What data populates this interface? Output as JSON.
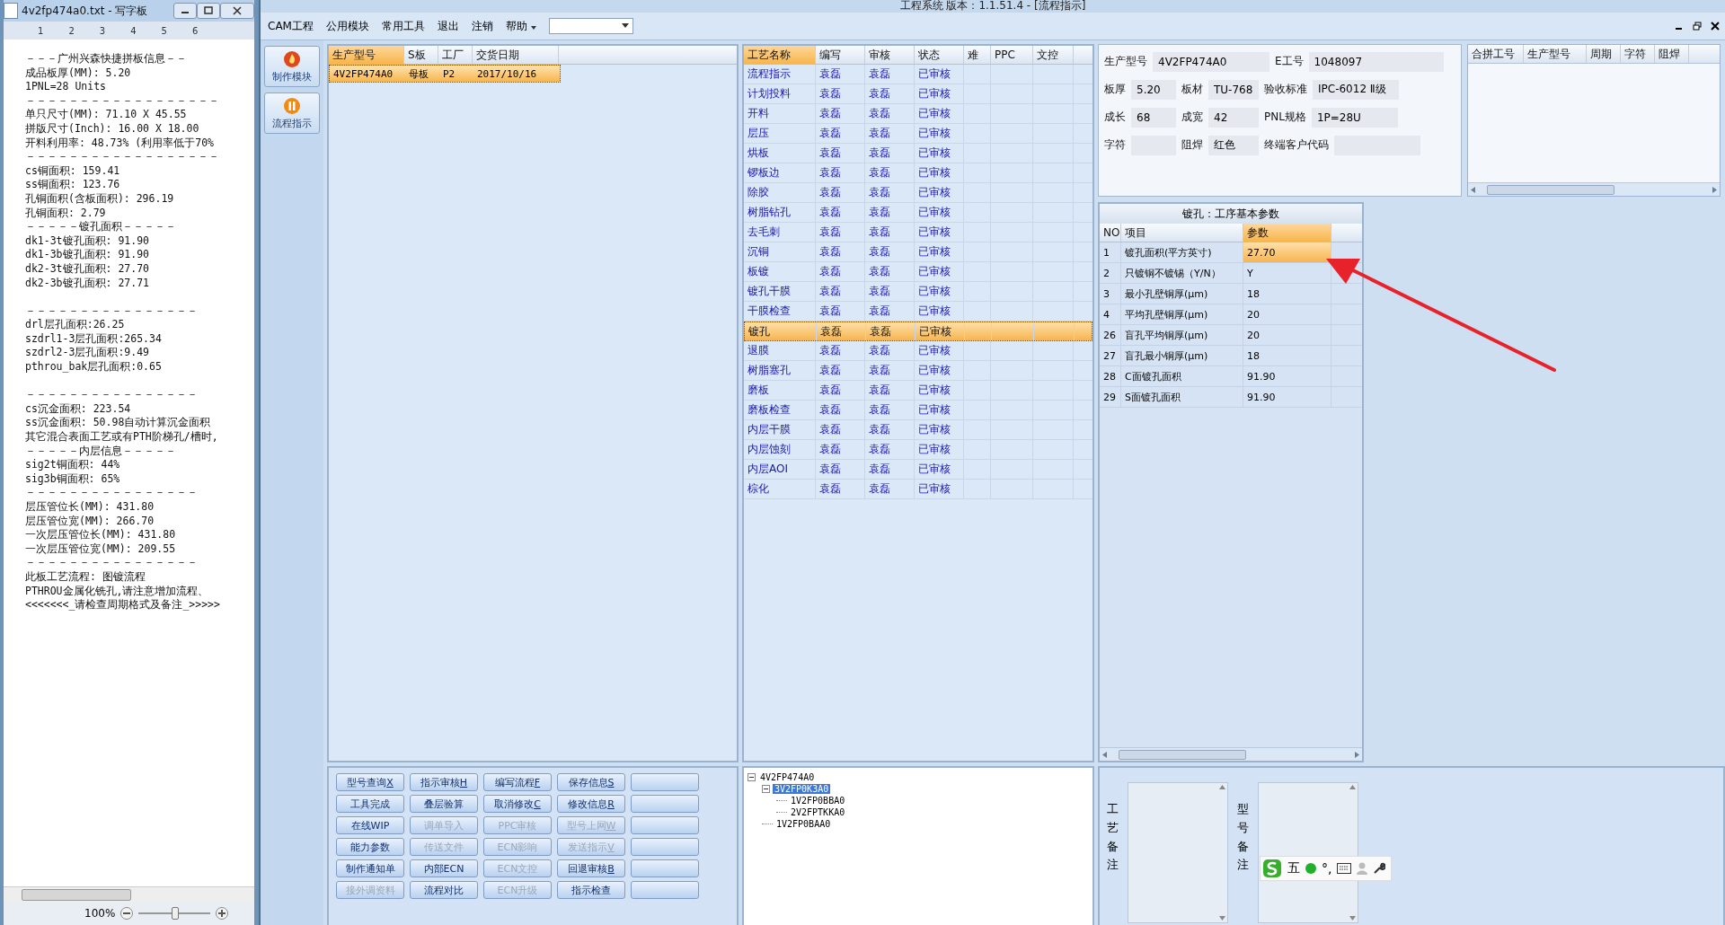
{
  "notepad": {
    "title": "4v2fp474a0.txt - 写字板",
    "ruler": [
      "1",
      "2",
      "3",
      "4",
      "5",
      "6"
    ],
    "lines": [
      {
        "text": "－－－广州兴森快捷拼板信息－－"
      },
      {
        "text": "成品板厚(MM): 5.20"
      },
      {
        "text": "1PNL=28 Units"
      },
      {
        "text": "－－－－－－－－－－－－－－－－－－"
      },
      {
        "text": "单只尺寸(MM): 71.10 X 45.55"
      },
      {
        "text": "拼版尺寸(Inch): 16.00 X 18.00"
      },
      {
        "text": "开料利用率: 48.73% (利用率低于70%"
      },
      {
        "text": "－－－－－－－－－－－－－－－－－－"
      },
      {
        "text": "cs铜面积: 159.41"
      },
      {
        "text": "ss铜面积: 123.76"
      },
      {
        "text": "孔铜面积(含板面积): 296.19"
      },
      {
        "text": "孔铜面积: 2.79"
      },
      {
        "text": "－－－－－镀孔面积－－－－－"
      },
      {
        "text": "dk1-3t镀孔面积: 91.90"
      },
      {
        "text": "dk1-3b镀孔面积: 91.90"
      },
      {
        "text": "dk2-3t镀孔面积: 27.70"
      },
      {
        "text": "dk2-3b镀孔面积: 27.71"
      },
      {
        "text": "－－－－－－－－－－－－－－－－",
        "blank_before": true
      },
      {
        "text": "drl层孔面积:26.25"
      },
      {
        "text": "szdrl1-3层孔面积:265.34"
      },
      {
        "text": "szdrl2-3层孔面积:9.49"
      },
      {
        "text": "pthrou_bak层孔面积:0.65"
      },
      {
        "text": "－－－－－－－－－－－－－－－－",
        "blank_before": true
      },
      {
        "text": "cs沉金面积: 223.54"
      },
      {
        "text": "ss沉金面积: 50.98自动计算沉金面积"
      },
      {
        "text": "其它混合表面工艺或有PTH阶梯孔/槽时,"
      },
      {
        "text": "－－－－－内层信息－－－－－"
      },
      {
        "text": "sig2t铜面积: 44%"
      },
      {
        "text": "sig3b铜面积: 65%"
      },
      {
        "text": "－－－－－－－－－－－－－－－－"
      },
      {
        "text": "层压管位长(MM): 431.80"
      },
      {
        "text": "层压管位宽(MM): 266.70"
      },
      {
        "text": "一次层压管位长(MM): 431.80"
      },
      {
        "text": "一次层压管位宽(MM): 209.55"
      },
      {
        "text": "－－－－－－－－－－－－－－－－"
      },
      {
        "text": "此板工艺流程: 图镀流程"
      },
      {
        "text": "PTHROU金属化铣孔,请注意增加流程、"
      },
      {
        "text": "<<<<<<<_请检查周期格式及备注_>>>>>"
      }
    ],
    "zoom": "100%",
    "zoom_slider": {
      "level": 0.5
    }
  },
  "window": {
    "title": "工程系统  版本：1.1.51.4 - [流程指示]"
  },
  "menu": [
    {
      "label": "CAM工程",
      "kind": "item"
    },
    {
      "label": "公用模块",
      "kind": "item"
    },
    {
      "label": "常用工具",
      "kind": "item"
    },
    {
      "label": "退出",
      "kind": "item"
    },
    {
      "label": "注销",
      "kind": "item"
    },
    {
      "label": "帮助",
      "kind": "dropdown"
    }
  ],
  "nav": [
    {
      "label": "制作模块",
      "kind": "make"
    },
    {
      "label": "流程指示",
      "kind": "flow"
    }
  ],
  "models": {
    "columns": [
      {
        "label": "生产型号",
        "highlighted": true
      },
      {
        "label": "S板",
        "highlighted": false
      },
      {
        "label": "工厂",
        "highlighted": false
      },
      {
        "label": "交货日期",
        "highlighted": false
      }
    ],
    "rows": [
      {
        "cells": [
          "4V2FP474A0",
          "母板",
          "P2",
          "2017/10/16"
        ],
        "selected": true
      }
    ]
  },
  "process": {
    "columns": [
      {
        "label": "工艺名称",
        "highlighted": true
      },
      {
        "label": "编写",
        "highlighted": false
      },
      {
        "label": "审核",
        "highlighted": false
      },
      {
        "label": "状态",
        "highlighted": false
      },
      {
        "label": "难",
        "highlighted": false
      },
      {
        "label": "PPC",
        "highlighted": false
      },
      {
        "label": "文控",
        "highlighted": false
      }
    ],
    "rows": [
      {
        "cells": [
          "流程指示",
          "袁磊",
          "袁磊",
          "已审核"
        ],
        "selected": false
      },
      {
        "cells": [
          "计划投料",
          "袁磊",
          "袁磊",
          "已审核"
        ],
        "selected": false
      },
      {
        "cells": [
          "开料",
          "袁磊",
          "袁磊",
          "已审核"
        ],
        "selected": false
      },
      {
        "cells": [
          "层压",
          "袁磊",
          "袁磊",
          "已审核"
        ],
        "selected": false
      },
      {
        "cells": [
          "烘板",
          "袁磊",
          "袁磊",
          "已审核"
        ],
        "selected": false
      },
      {
        "cells": [
          "锣板边",
          "袁磊",
          "袁磊",
          "已审核"
        ],
        "selected": false
      },
      {
        "cells": [
          "除胶",
          "袁磊",
          "袁磊",
          "已审核"
        ],
        "selected": false
      },
      {
        "cells": [
          "树脂钻孔",
          "袁磊",
          "袁磊",
          "已审核"
        ],
        "selected": false
      },
      {
        "cells": [
          "去毛刺",
          "袁磊",
          "袁磊",
          "已审核"
        ],
        "selected": false
      },
      {
        "cells": [
          "沉铜",
          "袁磊",
          "袁磊",
          "已审核"
        ],
        "selected": false
      },
      {
        "cells": [
          "板镀",
          "袁磊",
          "袁磊",
          "已审核"
        ],
        "selected": false
      },
      {
        "cells": [
          "镀孔干膜",
          "袁磊",
          "袁磊",
          "已审核"
        ],
        "selected": false
      },
      {
        "cells": [
          "干膜检查",
          "袁磊",
          "袁磊",
          "已审核"
        ],
        "selected": false
      },
      {
        "cells": [
          "镀孔",
          "袁磊",
          "袁磊",
          "已审核"
        ],
        "selected": true
      },
      {
        "cells": [
          "退膜",
          "袁磊",
          "袁磊",
          "已审核"
        ],
        "selected": false
      },
      {
        "cells": [
          "树脂塞孔",
          "袁磊",
          "袁磊",
          "已审核"
        ],
        "selected": false
      },
      {
        "cells": [
          "磨板",
          "袁磊",
          "袁磊",
          "已审核"
        ],
        "selected": false
      },
      {
        "cells": [
          "磨板检查",
          "袁磊",
          "袁磊",
          "已审核"
        ],
        "selected": false
      },
      {
        "cells": [
          "内层干膜",
          "袁磊",
          "袁磊",
          "已审核"
        ],
        "selected": false
      },
      {
        "cells": [
          "内层蚀刻",
          "袁磊",
          "袁磊",
          "已审核"
        ],
        "selected": false
      },
      {
        "cells": [
          "内层AOI",
          "袁磊",
          "袁磊",
          "已审核"
        ],
        "selected": false
      },
      {
        "cells": [
          "棕化",
          "袁磊",
          "袁磊",
          "已审核"
        ],
        "selected": false
      }
    ]
  },
  "form": [
    [
      {
        "label": "生产型号",
        "value": "4V2FP474A0",
        "wide": true
      },
      {
        "label": "E工号",
        "value": "1048097",
        "wide": true
      }
    ],
    [
      {
        "label": "板厚",
        "value": "5.20"
      },
      {
        "label": "板材",
        "value": "TU-768"
      },
      {
        "label": "验收标准",
        "value": "IPC-6012 Ⅱ级"
      }
    ],
    [
      {
        "label": "成长",
        "value": "68"
      },
      {
        "label": "成宽",
        "value": "42"
      },
      {
        "label": "PNL规格",
        "value": "1P=28U"
      }
    ],
    [
      {
        "label": "字符"
      },
      {
        "label": "阻焊",
        "value": "红色"
      },
      {
        "label": "终端客户代码"
      }
    ]
  ],
  "merge_table": {
    "columns": [
      "合拼工号",
      "生产型号",
      "周期",
      "字符",
      "阻焊"
    ]
  },
  "params": {
    "title": "镀孔：工序基本参数",
    "columns": [
      {
        "label": "NO",
        "highlighted": false
      },
      {
        "label": "项目",
        "highlighted": false
      },
      {
        "label": "参数",
        "highlighted": true
      }
    ],
    "rows": [
      {
        "no": "1",
        "item": "镀孔面积(平方英寸)",
        "value": "27.70",
        "selected": true
      },
      {
        "no": "2",
        "item": "只镀铜不镀锡（Y/N）",
        "value": "Y",
        "selected": false
      },
      {
        "no": "3",
        "item": "最小孔壁铜厚(μm)",
        "value": "18",
        "selected": false
      },
      {
        "no": "4",
        "item": "平均孔壁铜厚(μm)",
        "value": "20",
        "selected": false
      },
      {
        "no": "26",
        "item": "盲孔平均铜厚(μm)",
        "value": "20",
        "selected": false
      },
      {
        "no": "27",
        "item": "盲孔最小铜厚(μm)",
        "value": "18",
        "selected": false
      },
      {
        "no": "28",
        "item": "C面镀孔面积",
        "value": "91.90",
        "selected": false
      },
      {
        "no": "29",
        "item": "S面镀孔面积",
        "value": "91.90",
        "selected": false
      }
    ]
  },
  "buttons": [
    {
      "kind": "command",
      "label": "型号查询",
      "shortcut": "X",
      "disabled": false
    },
    {
      "kind": "command",
      "label": "指示审核",
      "shortcut": "H",
      "disabled": false
    },
    {
      "kind": "command",
      "label": "编写流程",
      "shortcut": "F",
      "disabled": false
    },
    {
      "kind": "command",
      "label": "保存信息",
      "shortcut": "S",
      "disabled": false
    },
    {
      "kind": "empty"
    },
    {
      "kind": "command",
      "label": "工具完成",
      "disabled": false
    },
    {
      "kind": "command",
      "label": "叠层验算",
      "disabled": false
    },
    {
      "kind": "command",
      "label": "取消修改",
      "shortcut": "C",
      "disabled": false
    },
    {
      "kind": "command",
      "label": "修改信息",
      "shortcut": "R",
      "disabled": false
    },
    {
      "kind": "empty"
    },
    {
      "kind": "command",
      "label": "在线WIP",
      "disabled": false
    },
    {
      "kind": "command",
      "label": "调单导入",
      "disabled": true
    },
    {
      "kind": "command",
      "label": "PPC审核",
      "disabled": true
    },
    {
      "kind": "command",
      "label": "型号上网",
      "shortcut": "W",
      "disabled": true
    },
    {
      "kind": "empty"
    },
    {
      "kind": "command",
      "label": "能力参数",
      "disabled": false
    },
    {
      "kind": "command",
      "label": "传送文件",
      "disabled": true
    },
    {
      "kind": "command",
      "label": "ECN影响",
      "disabled": true
    },
    {
      "kind": "command",
      "label": "发送指示",
      "shortcut": "V",
      "disabled": true
    },
    {
      "kind": "empty"
    },
    {
      "kind": "command",
      "label": "制作通知单",
      "disabled": false
    },
    {
      "kind": "command",
      "label": "内部ECN",
      "disabled": false
    },
    {
      "kind": "command",
      "label": "ECN文控",
      "disabled": true
    },
    {
      "kind": "command",
      "label": "回退审核",
      "shortcut": "B",
      "disabled": false
    },
    {
      "kind": "empty"
    },
    {
      "kind": "command",
      "label": "接外调资料",
      "disabled": true
    },
    {
      "kind": "command",
      "label": "流程对比",
      "disabled": false
    },
    {
      "kind": "command",
      "label": "ECN升级",
      "disabled": true
    },
    {
      "kind": "command",
      "label": "指示检查",
      "disabled": false
    },
    {
      "kind": "empty"
    }
  ],
  "tree": [
    {
      "label": "4V2FP474A0",
      "expanded": true,
      "selected": false,
      "children": [
        {
          "label": "3V2FP0K3A0",
          "expanded": true,
          "selected": true,
          "children": [
            {
              "label": "1V2FP0BBA0",
              "selected": false
            },
            {
              "label": "2V2FPTKKA0",
              "selected": false
            }
          ]
        },
        {
          "label": "1V2FP0BAA0",
          "selected": false
        }
      ]
    }
  ],
  "notes": [
    {
      "label": "工艺备注"
    },
    {
      "label": "型号备注"
    }
  ],
  "ime": {
    "mode": "五",
    "punct": "°,"
  }
}
